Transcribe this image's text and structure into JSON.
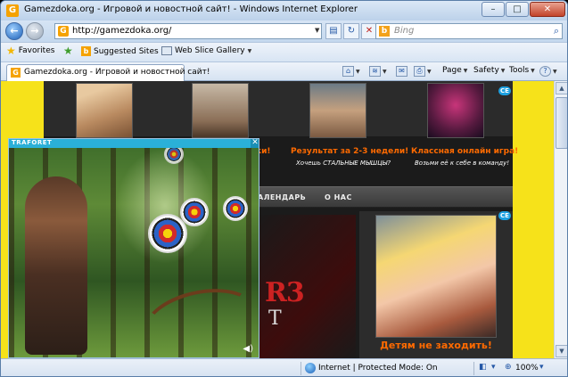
{
  "window": {
    "title": "Gamezdoka.org - Игровой и новостной сайт! - Windows Internet Explorer",
    "controls": {
      "minimize": "–",
      "maximize": "□",
      "close": "✕"
    }
  },
  "addressbar": {
    "url": "http://gamezdoka.org/",
    "search_placeholder": "Bing",
    "icons": [
      "compatibility-icon",
      "refresh-icon",
      "stop-icon"
    ]
  },
  "favorites": {
    "label": "Favorites",
    "items": [
      {
        "label": "Suggested Sites",
        "icon": "suggested-sites-icon"
      },
      {
        "label": "Web Slice Gallery",
        "icon": "web-slice-icon"
      }
    ]
  },
  "tab": {
    "label": "Gamezdoka.org - Игровой и новостной сайт!"
  },
  "commandbar": {
    "page": "Page",
    "safety": "Safety",
    "tools": "Tools",
    "help": "?"
  },
  "site": {
    "promos": [
      {
        "title": "ки!",
        "sub": ""
      },
      {
        "title": "Результат за 2-3 недели!",
        "sub": "Хочешь СТАЛЬНЫЕ МЫШЦЫ?"
      },
      {
        "title": "Классная онлайн игра!",
        "sub": "Возьми её к себе в команду!"
      }
    ],
    "menu": [
      "АЛЕНДАРЬ",
      "О НАС"
    ],
    "badge": "CE",
    "banner_logo": "R3",
    "banner_sub": "T",
    "anime_caption": "Детям не заходить!"
  },
  "popup": {
    "brand": "TRAFORET",
    "close": "✕",
    "sound": "◀)"
  },
  "statusbar": {
    "zone": "Internet | Protected Mode: On",
    "zoom": "100%"
  },
  "colors": {
    "accent_orange": "#ff6a00",
    "site_yellow": "#f6e21a",
    "popup_header": "#2ab0d8"
  }
}
